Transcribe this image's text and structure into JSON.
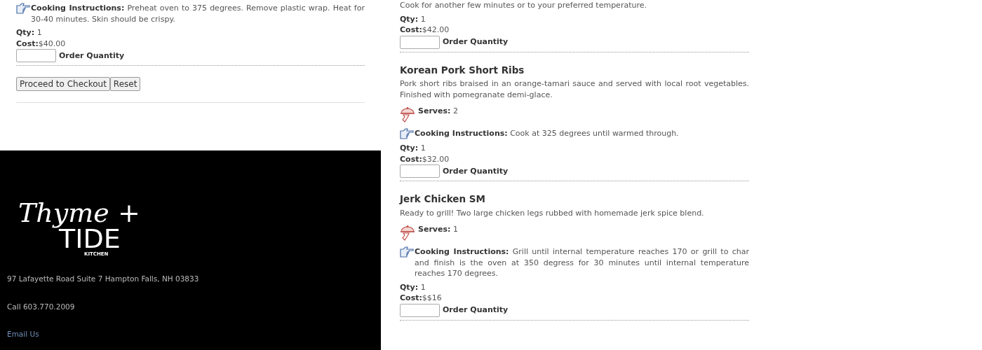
{
  "left_item": {
    "cooking_label": "Cooking Instructions:",
    "cooking_text": "Preheat oven to 375 degrees. Remove plastic wrap. Heat for 30-40 minutes. Skin should be crispy.",
    "qty_label": "Qty:",
    "qty": "1",
    "cost_label": "Cost:",
    "cost": "$40.00",
    "order_label": "Order Quantity"
  },
  "buttons": [
    "Proceed to Checkout",
    "Reset"
  ],
  "footer": {
    "logo": {
      "line1": "Thyme +",
      "line2": "TIDE",
      "line3": "KITCHEN"
    },
    "address": "97 Lafayette Road Suite 7 Hampton Falls, NH 03833",
    "phone": "Call 603.770.2009",
    "email_link": "Email Us"
  },
  "right_items": [
    {
      "cooking_tail": "Cook for another few minutes or to your preferred temperature.",
      "qty_label": "Qty:",
      "qty": "1",
      "cost_label": "Cost:",
      "cost": "$42.00",
      "order_label": "Order Quantity"
    },
    {
      "title": "Korean Pork Short Ribs",
      "description": "Pork short ribs braised in an orange-tamari sauce and served with local root vegetables. Finished with pomegranate demi-glace.",
      "serves_label": "Serves:",
      "serves": "2",
      "cooking_label": "Cooking Instructions:",
      "cooking_text": "Cook at 325 degrees until warmed through.",
      "qty_label": "Qty:",
      "qty": "1",
      "cost_label": "Cost:",
      "cost": "$32.00",
      "order_label": "Order Quantity"
    },
    {
      "title": "Jerk Chicken SM",
      "description": "Ready to grill! Two large chicken legs rubbed with homemade jerk spice blend.",
      "serves_label": "Serves:",
      "serves": "1",
      "cooking_label": "Cooking Instructions:",
      "cooking_text": "Grill until internal temperature reaches 170 or grill to char and finish is the oven at 350 degress for 30 minutes until internal temperature reaches 170 degrees.",
      "qty_label": "Qty:",
      "qty": "1",
      "cost_label": "Cost:",
      "cost": "$$16",
      "order_label": "Order Quantity"
    }
  ]
}
